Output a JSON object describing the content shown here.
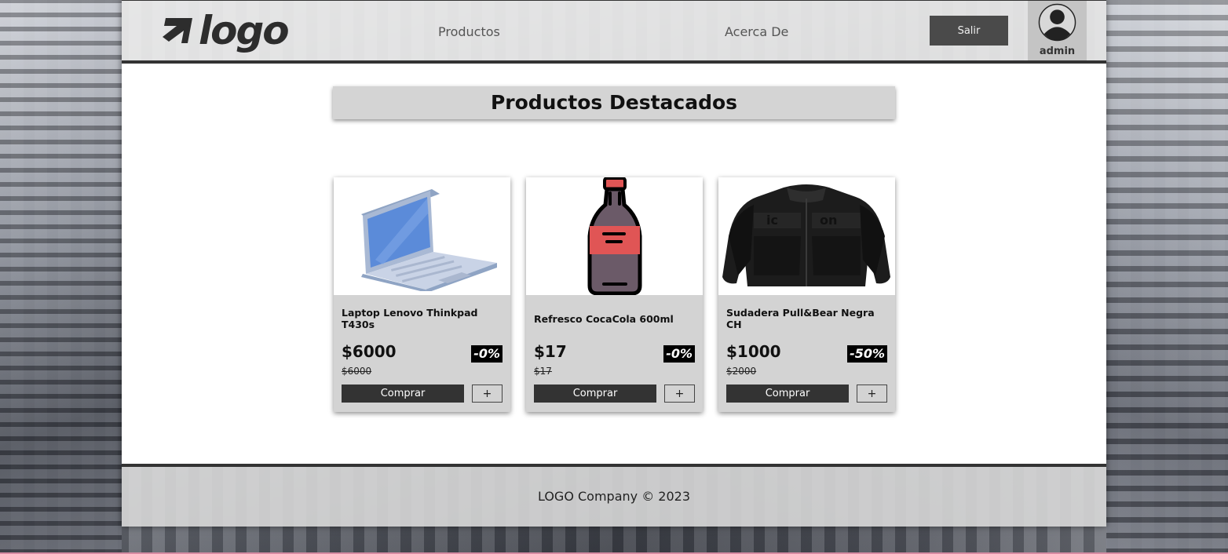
{
  "header": {
    "logo_text": "logo",
    "nav": [
      {
        "label": "Productos"
      },
      {
        "label": "Acerca De"
      }
    ],
    "logout_label": "Salir",
    "user_name": "admin"
  },
  "main": {
    "section_title": "Productos Destacados",
    "products": [
      {
        "name": "Laptop Lenovo Thinkpad T430s",
        "price": "$6000",
        "old_price": "$6000",
        "discount": "-0%",
        "buy_label": "Comprar",
        "add_label": "+",
        "image": "laptop-image"
      },
      {
        "name": "Refresco CocaCola 600ml",
        "price": "$17",
        "old_price": "$17",
        "discount": "-0%",
        "buy_label": "Comprar",
        "add_label": "+",
        "image": "soda-bottle-image"
      },
      {
        "name": "Sudadera Pull&Bear Negra CH",
        "price": "$1000",
        "old_price": "$2000",
        "discount": "-50%",
        "buy_label": "Comprar",
        "add_label": "+",
        "image": "jacket-image"
      }
    ]
  },
  "footer": {
    "text": "LOGO Company © 2023"
  },
  "colors": {
    "header_bg": "#e6e6e6",
    "dark": "#333333",
    "card_bg": "#d3d3d3",
    "accent_red": "#e05555",
    "laptop_screen": "#5b8bd9"
  }
}
